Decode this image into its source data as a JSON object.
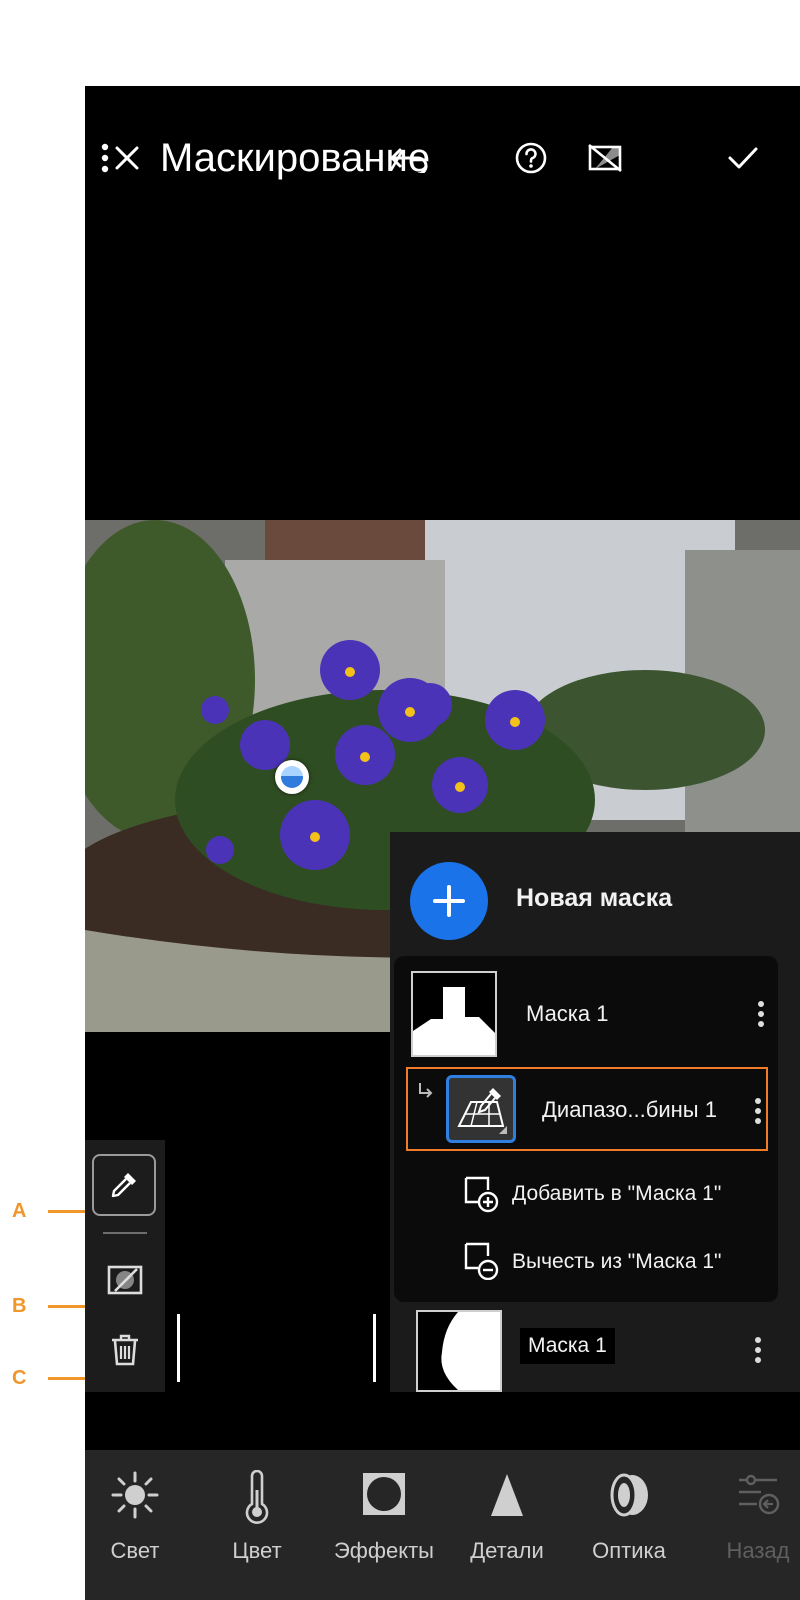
{
  "header": {
    "title": "Маскирование",
    "close_icon": "close-icon",
    "help_icon": "help-icon",
    "overlay_toggle_icon": "mask-overlay-off-icon",
    "more_icon": "more-vertical-icon",
    "done_icon": "checkmark-icon"
  },
  "panel": {
    "new_mask_label": "Новая маска",
    "mask1_label": "Маска 1",
    "component_label": "Диапазо...бины 1",
    "add_label": "Добавить в \"Маска 1\"",
    "subtract_label": "Вычесть из \"Маска 1\"",
    "mask2_label": "Маска 1"
  },
  "callouts": {
    "a": "A",
    "b": "B",
    "c": "C"
  },
  "toolbar": {
    "items": [
      {
        "label": "Свет",
        "icon": "sun-icon"
      },
      {
        "label": "Цвет",
        "icon": "thermometer-icon"
      },
      {
        "label": "Эффекты",
        "icon": "vignette-icon"
      },
      {
        "label": "Детали",
        "icon": "triangle-icon"
      },
      {
        "label": "Оптика",
        "icon": "lens-icon"
      },
      {
        "label": "Назад",
        "icon": "back-sliders-icon"
      }
    ]
  },
  "colors": {
    "accent_blue": "#1a73e8",
    "highlight_orange": "#f07c2a",
    "callout_orange": "#f0962a"
  }
}
